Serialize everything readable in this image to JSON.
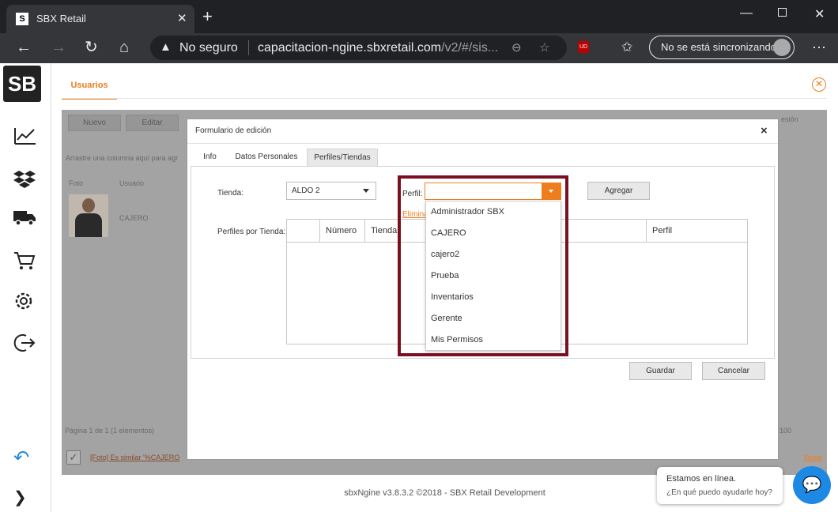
{
  "browser": {
    "tab_title": "SBX Retail",
    "tab_favicon": "S",
    "new_tab_label": "+",
    "security_label": "No seguro",
    "url_host": "capacitacion-ngine.sbxretail.com",
    "url_path": "/v2/#/sis...",
    "sync_label": "No se está sincronizando",
    "extension_badge": "UD"
  },
  "sidebar": {
    "logo_text": "SB",
    "items": [
      "chart-line-icon",
      "dropbox-icon",
      "truck-icon",
      "cart-icon",
      "gear-icon",
      "logout-icon",
      "undo-icon",
      "chevron-right-icon"
    ]
  },
  "page": {
    "tab_label": "Usuarios",
    "footer": "sbxNgine v3.8.3.2 ©2018 - SBX Retail Development"
  },
  "grid_bg": {
    "nuevo": "Nuevo",
    "editar": "Editar",
    "drag_hint": "Arrastre una columna aquí para agr",
    "col_foto": "Foto",
    "col_usuario": "Usuario",
    "row_user": "CAJERO",
    "pager": "Página 1 de 1 (1 elementos)",
    "page_size": "100",
    "filter_text": "[Foto] Es similar '%CAJERO",
    "vaciar": "Vaciar",
    "sesion_text": "esión"
  },
  "modal": {
    "title": "Formulario de edición",
    "close": "×",
    "tabs": [
      "Info",
      "Datos Personales",
      "Perfiles/Tiendas"
    ],
    "tienda_label": "Tienda:",
    "tienda_value": "ALDO 2",
    "perfil_label": "Perfil:",
    "perfil_value": "",
    "agregar": "Agregar",
    "eliminar": "Elimina",
    "perfiles_por_tienda_label": "Perfiles por Tienda:",
    "table_headers": [
      "",
      "Número",
      "Tienda",
      "Perfil"
    ],
    "perfil_options": [
      "Administrador SBX",
      "CAJERO",
      "cajero2",
      "Prueba",
      "Inventarios",
      "Gerente",
      "Mis Permisos"
    ],
    "guardar": "Guardar",
    "cancelar": "Cancelar"
  },
  "chat": {
    "line1": "Estamos en línea.",
    "line2": "¿En qué puedo ayudarle hoy?"
  },
  "colors": {
    "accent": "#ee7d1e",
    "highlight_border": "#7b0f22",
    "chat_blue": "#1e88e5"
  }
}
